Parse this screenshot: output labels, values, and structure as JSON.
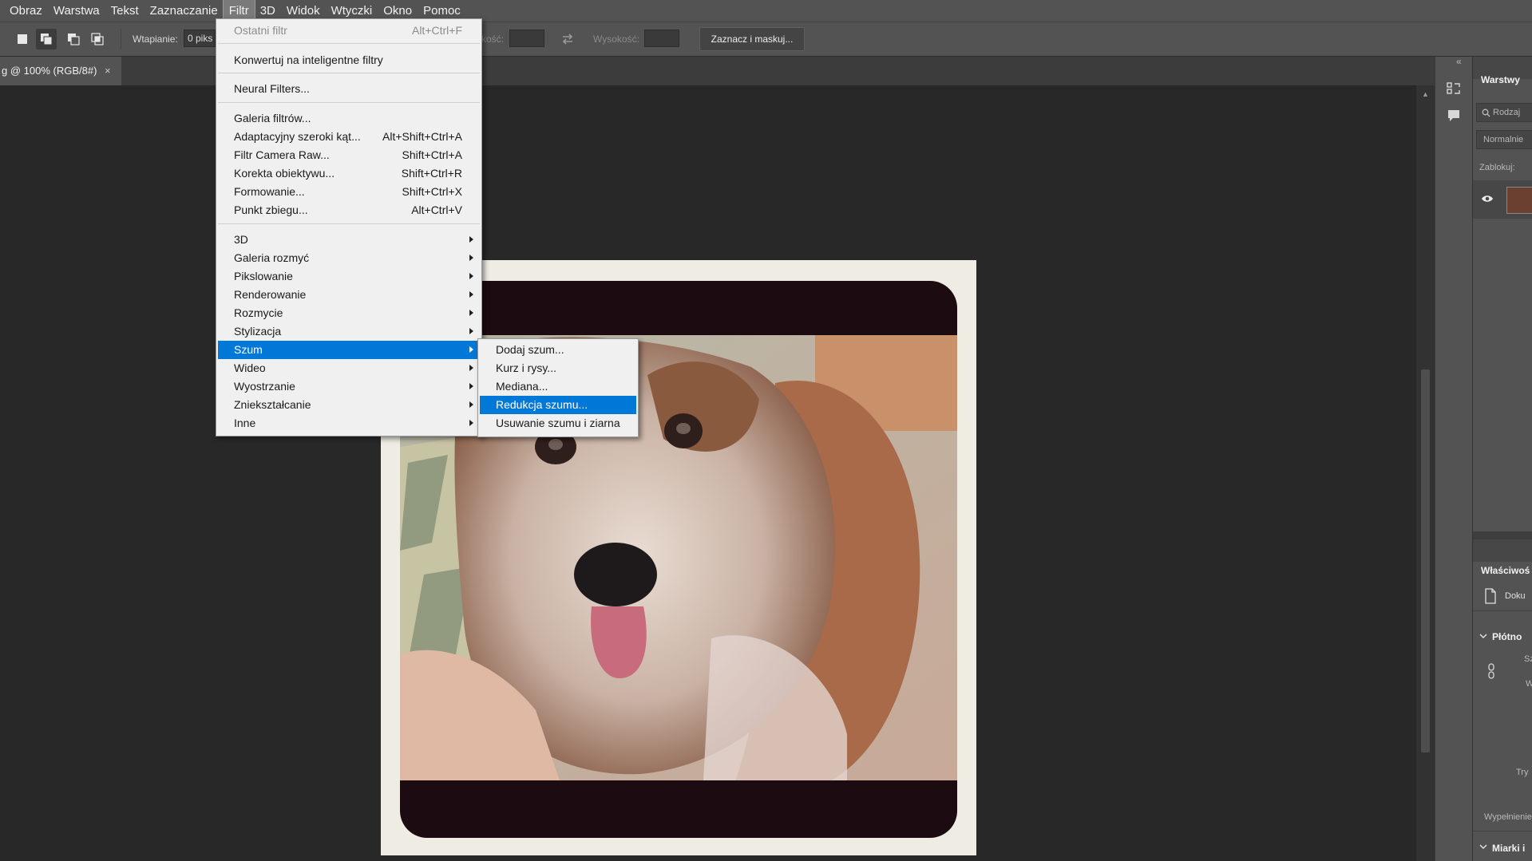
{
  "menubar": {
    "items": [
      "Obraz",
      "Warstwa",
      "Tekst",
      "Zaznaczanie",
      "Filtr",
      "3D",
      "Widok",
      "Wtyczki",
      "Okno",
      "Pomoc"
    ],
    "active_item": "Filtr"
  },
  "options_bar": {
    "feather_label": "Wtapianie:",
    "feather_value": "0 piks",
    "width_label_partial": "kość:",
    "height_label": "Wysokość:",
    "select_mask_label": "Zaznacz i maskuj..."
  },
  "document_tab": {
    "title": "g @ 100% (RGB/8#)",
    "close": "×"
  },
  "filter_menu": {
    "last_filter": {
      "label": "Ostatni filtr",
      "shortcut": "Alt+Ctrl+F"
    },
    "convert_smart": "Konwertuj na inteligentne filtry",
    "neural_filters": "Neural Filters...",
    "group_filters": [
      {
        "label": "Galeria filtrów...",
        "shortcut": ""
      },
      {
        "label": "Adaptacyjny szeroki kąt...",
        "shortcut": "Alt+Shift+Ctrl+A"
      },
      {
        "label": "Filtr Camera Raw...",
        "shortcut": "Shift+Ctrl+A"
      },
      {
        "label": "Korekta obiektywu...",
        "shortcut": "Shift+Ctrl+R"
      },
      {
        "label": "Formowanie...",
        "shortcut": "Shift+Ctrl+X"
      },
      {
        "label": "Punkt zbiegu...",
        "shortcut": "Alt+Ctrl+V"
      }
    ],
    "submenus": [
      "3D",
      "Galeria rozmyć",
      "Pikslowanie",
      "Renderowanie",
      "Rozmycie",
      "Stylizacja",
      "Szum",
      "Wideo",
      "Wyostrzanie",
      "Zniekształcanie",
      "Inne"
    ],
    "highlighted_submenu": "Szum"
  },
  "noise_submenu": {
    "items": [
      "Dodaj szum...",
      "Kurz i rysy...",
      "Mediana...",
      "Redukcja szumu...",
      "Usuwanie szumu i ziarna"
    ],
    "highlighted": "Redukcja szumu..."
  },
  "right_panel": {
    "layers_tab": "Warstwy",
    "kind_search": "Rodzaj",
    "blend_mode": "Normalnie",
    "lock_label": "Zablokuj:",
    "properties_tab": "Właściwoś",
    "doc_label": "Doku",
    "canvas_section": "Płótno",
    "s_label": "Sz",
    "w_label": "W",
    "mode_label": "Try",
    "fill_label": "Wypełnienie",
    "rulers_section": "Miarki i"
  },
  "colors": {
    "menu_highlight": "#0078d7",
    "ui_gray": "#535353",
    "workspace": "#282828"
  }
}
